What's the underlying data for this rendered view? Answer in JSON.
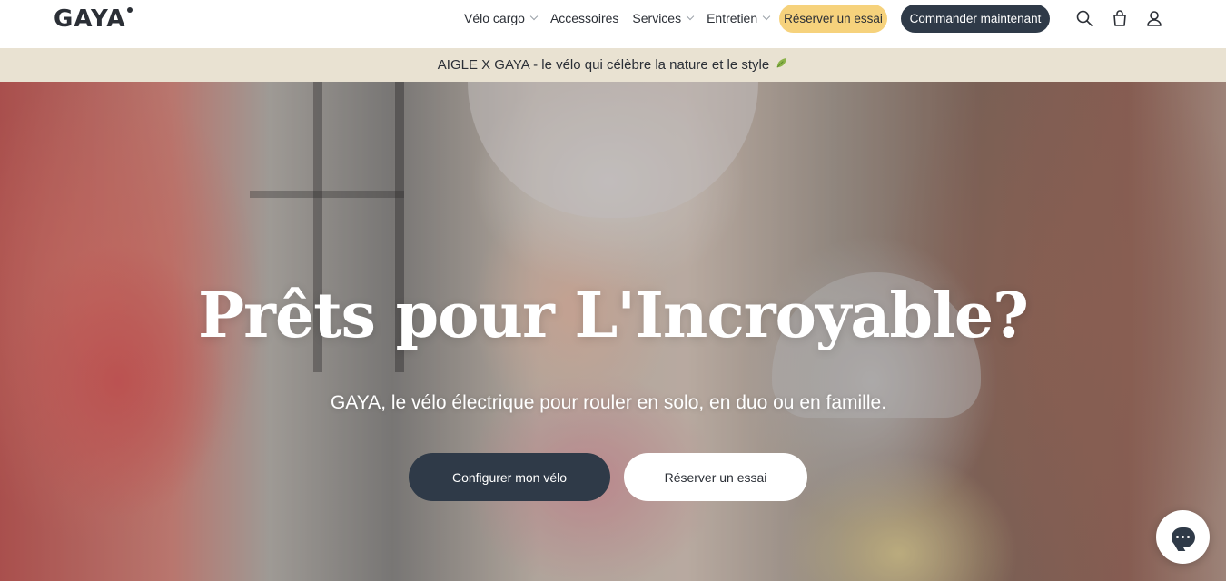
{
  "header": {
    "logo": "GAYA",
    "nav": [
      {
        "label": "Vélo cargo",
        "has_dropdown": true
      },
      {
        "label": "Accessoires",
        "has_dropdown": false
      },
      {
        "label": "Services",
        "has_dropdown": true
      },
      {
        "label": "Entretien",
        "has_dropdown": true
      }
    ],
    "trial_button": "Réserver un essai",
    "order_button": "Commander maintenant",
    "icons": [
      "search-icon",
      "bag-icon",
      "account-icon"
    ]
  },
  "announcement": {
    "text": "AIGLE X GAYA - le vélo qui célèbre la nature et le style",
    "icon": "leaf-icon"
  },
  "hero": {
    "title": "Prêts pour L'Incroyable?",
    "subtitle": "GAYA, le vélo électrique pour rouler en solo, en duo ou en famille.",
    "primary_button": "Configurer mon vélo",
    "secondary_button": "Réserver un essai"
  },
  "chat": {
    "icon": "chat-icon"
  },
  "colors": {
    "dark": "#2f3a48",
    "accent_yellow": "#f6d27c",
    "announce_bg": "#e9e2d2"
  }
}
